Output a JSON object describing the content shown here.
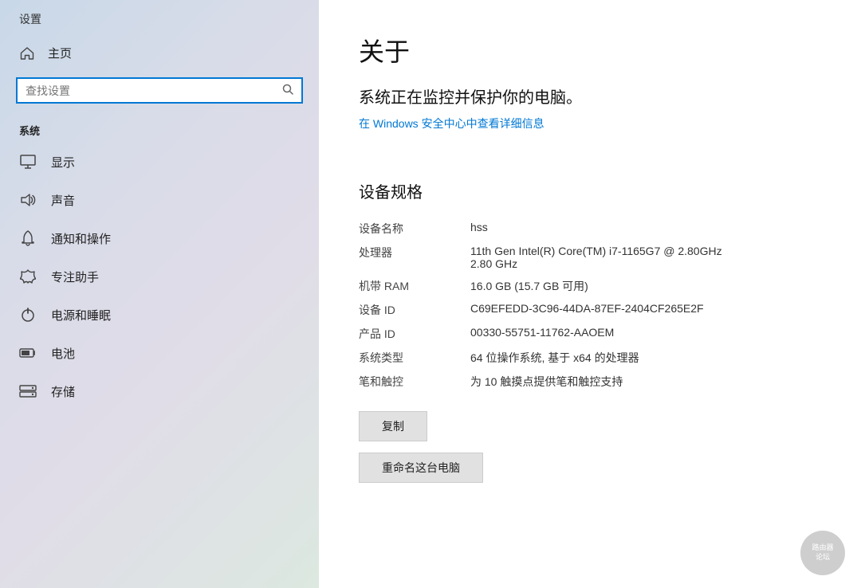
{
  "sidebar": {
    "header": "设置",
    "home_label": "主页",
    "search_placeholder": "查找设置",
    "section_system": "系统",
    "nav_items": [
      {
        "label": "显示",
        "icon": "monitor"
      },
      {
        "label": "声音",
        "icon": "sound"
      },
      {
        "label": "通知和操作",
        "icon": "notification"
      },
      {
        "label": "专注助手",
        "icon": "focus"
      },
      {
        "label": "电源和睡眠",
        "icon": "power"
      },
      {
        "label": "电池",
        "icon": "battery"
      },
      {
        "label": "存储",
        "icon": "storage"
      }
    ]
  },
  "main": {
    "page_title": "关于",
    "protection_text": "系统正在监控并保护你的电脑。",
    "security_link": "在 Windows 安全中心中查看详细信息",
    "device_spec_title": "设备规格",
    "specs": [
      {
        "label": "设备名称",
        "value": "hss"
      },
      {
        "label": "处理器",
        "value": "11th Gen Intel(R) Core(TM) i7-1165G7 @ 2.80GHz\n2.80 GHz"
      },
      {
        "label": "机带 RAM",
        "value": "16.0 GB (15.7 GB 可用)"
      },
      {
        "label": "设备 ID",
        "value": "C69EFEDD-3C96-44DA-87EF-2404CF265E2F"
      },
      {
        "label": "产品 ID",
        "value": "00330-55751-11762-AAOEM"
      },
      {
        "label": "系统类型",
        "value": "64 位操作系统, 基于 x64 的处理器"
      },
      {
        "label": "笔和触控",
        "value": "为 10 触摸点提供笔和触控支持"
      }
    ],
    "btn_copy": "复制",
    "btn_rename": "重命名这台电脑"
  }
}
